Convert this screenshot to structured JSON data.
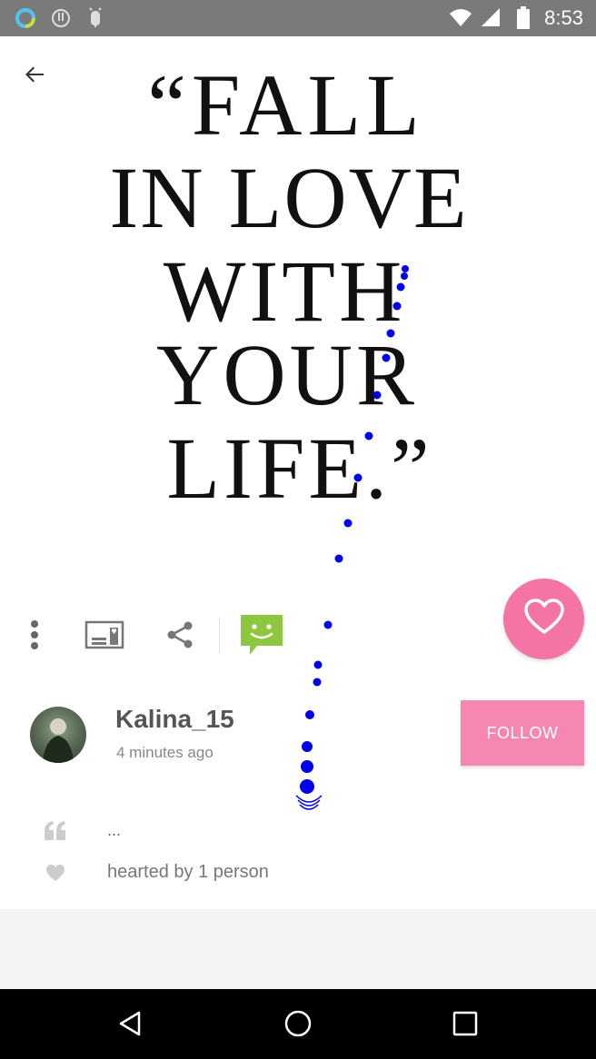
{
  "status_bar": {
    "time": "8:53",
    "icons": [
      "ring-app-icon",
      "alert-icon",
      "android-bug-icon",
      "wifi-icon",
      "signal-icon",
      "battery-icon"
    ]
  },
  "header": {
    "back_icon": "arrow-back-icon"
  },
  "post_image": {
    "quote_lines": [
      "“FALL",
      "IN LOVE",
      "WITH",
      "YOUR",
      "LIFE.”"
    ]
  },
  "toolbar": {
    "items": [
      {
        "icon": "more-vertical-icon"
      },
      {
        "icon": "save-card-icon"
      },
      {
        "icon": "share-icon"
      },
      {
        "icon": "message-smile-icon"
      }
    ],
    "heart_icon": "heart-outline-icon"
  },
  "author": {
    "username": "Kalina_15",
    "time_ago": "4 minutes ago",
    "follow_label": "FOLLOW"
  },
  "details": {
    "caption_icon": "quote-icon",
    "caption": "...",
    "hearts_icon": "heart-icon",
    "hearted_by": "hearted by 1 person"
  },
  "nav_bar": {
    "icons": [
      "back-triangle-icon",
      "home-circle-icon",
      "recents-square-icon"
    ]
  },
  "colors": {
    "status_bar": "#7a7a7a",
    "heart_fab": "#f474a5",
    "follow_button": "#f687b3",
    "message_green": "#8dc63f",
    "touch_trail": "#0000ee"
  }
}
